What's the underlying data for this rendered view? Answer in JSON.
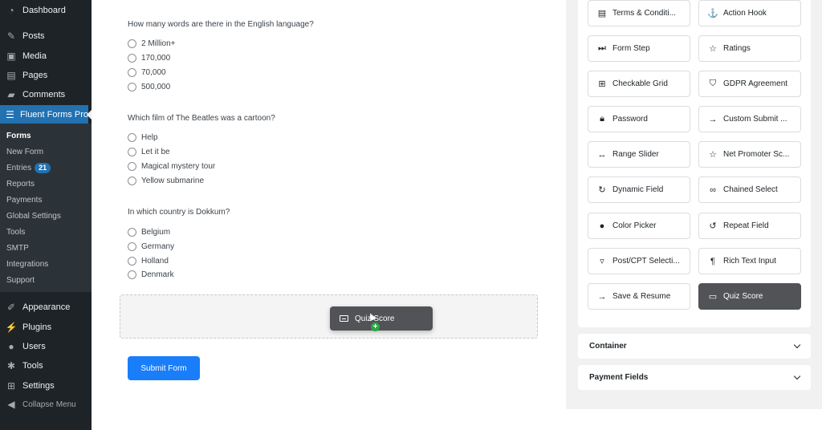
{
  "sidebar": {
    "top_items": [
      {
        "label": "Dashboard",
        "icon": "dashboard-icon"
      },
      {
        "label": "Posts",
        "icon": "pin-icon"
      },
      {
        "label": "Media",
        "icon": "media-icon"
      },
      {
        "label": "Pages",
        "icon": "pages-icon"
      },
      {
        "label": "Comments",
        "icon": "comment-icon"
      },
      {
        "label": "Fluent Forms Pro",
        "icon": "fluent-forms-icon"
      }
    ],
    "submenu": [
      {
        "label": "Forms"
      },
      {
        "label": "New Form"
      },
      {
        "label": "Entries",
        "badge": "21"
      },
      {
        "label": "Reports"
      },
      {
        "label": "Payments"
      },
      {
        "label": "Global Settings"
      },
      {
        "label": "Tools"
      },
      {
        "label": "SMTP"
      },
      {
        "label": "Integrations"
      },
      {
        "label": "Support"
      }
    ],
    "bottom_items": [
      {
        "label": "Appearance",
        "icon": "brush-icon"
      },
      {
        "label": "Plugins",
        "icon": "plugin-icon"
      },
      {
        "label": "Users",
        "icon": "user-icon"
      },
      {
        "label": "Tools",
        "icon": "wrench-icon"
      },
      {
        "label": "Settings",
        "icon": "settings-icon"
      },
      {
        "label": "Collapse Menu",
        "icon": "collapse-icon"
      }
    ]
  },
  "form": {
    "questions": [
      {
        "text": "How many words are there in the English language?",
        "options": [
          "2 Million+",
          "170,000",
          "70,000",
          "500,000"
        ]
      },
      {
        "text": "Which film of The Beatles was a cartoon?",
        "options": [
          "Help",
          "Let it be",
          "Magical mystery tour",
          "Yellow submarine"
        ]
      },
      {
        "text": "In which country is Dokkum?",
        "options": [
          "Belgium",
          "Germany",
          "Holland",
          "Denmark"
        ]
      }
    ],
    "drag_chip_label": "Quiz Score",
    "submit_label": "Submit Form"
  },
  "fields_panel": {
    "fields": [
      {
        "label": "Terms & Conditi...",
        "icon": "terms-icon"
      },
      {
        "label": "Action Hook",
        "icon": "hook-icon"
      },
      {
        "label": "Form Step",
        "icon": "step-icon"
      },
      {
        "label": "Ratings",
        "icon": "star-icon"
      },
      {
        "label": "Checkable Grid",
        "icon": "grid-icon"
      },
      {
        "label": "GDPR Agreement",
        "icon": "shield-icon"
      },
      {
        "label": "Password",
        "icon": "lock-icon"
      },
      {
        "label": "Custom Submit ...",
        "icon": "arrow-right-icon"
      },
      {
        "label": "Range Slider",
        "icon": "range-icon"
      },
      {
        "label": "Net Promoter Sc...",
        "icon": "star-icon"
      },
      {
        "label": "Dynamic Field",
        "icon": "refresh-icon"
      },
      {
        "label": "Chained Select",
        "icon": "link-icon"
      },
      {
        "label": "Color Picker",
        "icon": "drop-icon"
      },
      {
        "label": "Repeat Field",
        "icon": "repeat-icon"
      },
      {
        "label": "Post/CPT Selecti...",
        "icon": "post-icon"
      },
      {
        "label": "Rich Text Input",
        "icon": "rich-text-icon"
      },
      {
        "label": "Save & Resume",
        "icon": "arrow-right-icon"
      },
      {
        "label": "Quiz Score",
        "icon": "score-icon",
        "selected": true
      }
    ],
    "accordions": [
      {
        "label": "Container"
      },
      {
        "label": "Payment Fields"
      }
    ]
  },
  "colors": {
    "sidebar_bg": "#1d2327",
    "active_menu": "#2271b1",
    "submit_button": "#1a7efb",
    "selected_field": "#515356",
    "add_cursor": "#28a745"
  }
}
